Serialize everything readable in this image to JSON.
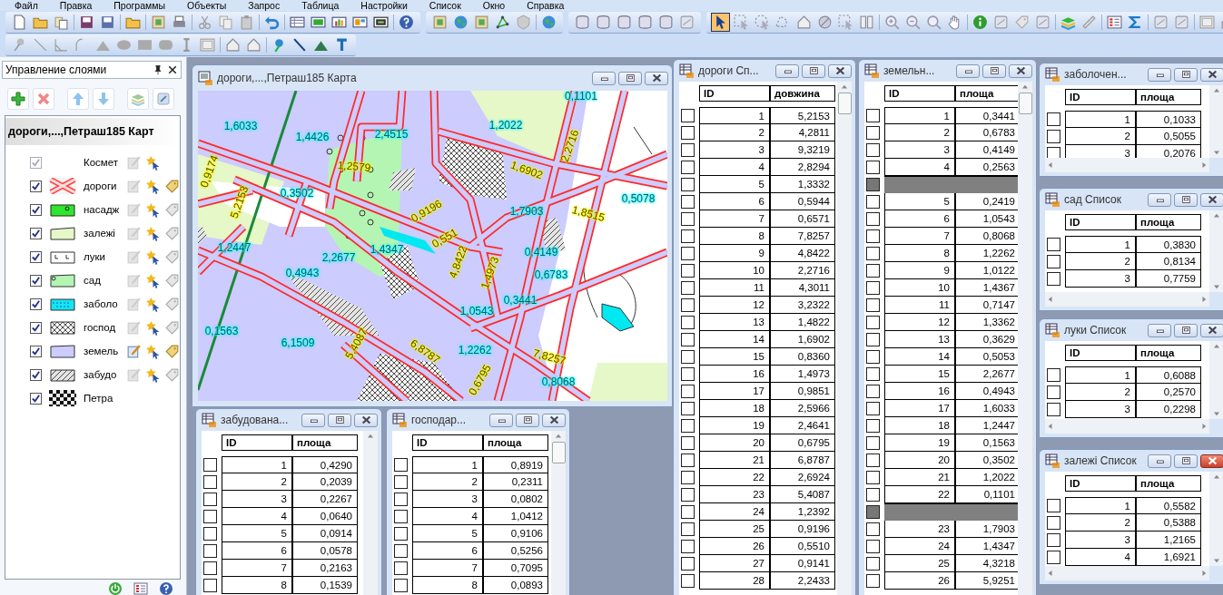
{
  "menu": [
    "Файл",
    "Правка",
    "Программы",
    "Объекты",
    "Запрос",
    "Таблица",
    "Настройки",
    "Список",
    "Окно",
    "Справка"
  ],
  "layer_panel": {
    "title": "Управление слоями",
    "map_name": "дороги,...,Петраш185 Карт",
    "layers": [
      {
        "name": "Космет",
        "kind": "cosmetic",
        "visible": true,
        "disabled": true,
        "editable": false
      },
      {
        "name": "дороги",
        "kind": "road",
        "visible": true,
        "disabled": false,
        "editable": false,
        "labeled": true
      },
      {
        "name": "насадж",
        "kind": "green",
        "visible": true,
        "disabled": false,
        "editable": false,
        "labeled": false
      },
      {
        "name": "залежі",
        "kind": "field",
        "visible": true,
        "disabled": false,
        "editable": false,
        "labeled": false
      },
      {
        "name": "луки",
        "kind": "meadow",
        "visible": true,
        "disabled": false,
        "editable": false,
        "labeled": false
      },
      {
        "name": "сад",
        "kind": "garden",
        "visible": true,
        "disabled": false,
        "editable": false,
        "labeled": false
      },
      {
        "name": "заболо",
        "kind": "swamp",
        "visible": true,
        "disabled": false,
        "editable": false,
        "labeled": false
      },
      {
        "name": "господ",
        "kind": "cross",
        "visible": true,
        "disabled": false,
        "editable": false,
        "labeled": false
      },
      {
        "name": "земель",
        "kind": "land",
        "visible": true,
        "disabled": false,
        "editable": true,
        "labeled": true
      },
      {
        "name": "забудо",
        "kind": "hatch",
        "visible": true,
        "disabled": false,
        "editable": false,
        "labeled": false
      },
      {
        "name": "Петра",
        "kind": "raster",
        "visible": true,
        "disabled": false
      }
    ]
  },
  "map_window": {
    "title": "дороги,...,Петраш185 Карта",
    "labels": [
      {
        "text": "0,1101",
        "kind": "area"
      },
      {
        "text": "1,6033",
        "kind": "area"
      },
      {
        "text": "1,4426",
        "kind": "area"
      },
      {
        "text": "2,4515",
        "kind": "area"
      },
      {
        "text": "1,2022",
        "kind": "area"
      },
      {
        "text": "2,2716",
        "kind": "road"
      },
      {
        "text": "0,9174",
        "kind": "road"
      },
      {
        "text": "1,2579",
        "kind": "road"
      },
      {
        "text": "1,6902",
        "kind": "road"
      },
      {
        "text": "0,3502",
        "kind": "area"
      },
      {
        "text": "5,2153",
        "kind": "road"
      },
      {
        "text": "0,5078",
        "kind": "area"
      },
      {
        "text": "1,7903",
        "kind": "area"
      },
      {
        "text": "1,8515",
        "kind": "road"
      },
      {
        "text": "0,9196",
        "kind": "road"
      },
      {
        "text": "0,551",
        "kind": "road"
      },
      {
        "text": "1,2447",
        "kind": "area"
      },
      {
        "text": "1,4347",
        "kind": "area"
      },
      {
        "text": "2,2677",
        "kind": "area"
      },
      {
        "text": "4,8422",
        "kind": "road"
      },
      {
        "text": "0,4149",
        "kind": "area"
      },
      {
        "text": "1,4973",
        "kind": "road"
      },
      {
        "text": "0,4943",
        "kind": "area"
      },
      {
        "text": "0,6783",
        "kind": "area"
      },
      {
        "text": "0,3441",
        "kind": "area"
      },
      {
        "text": "1,0543",
        "kind": "area"
      },
      {
        "text": "0,1563",
        "kind": "area"
      },
      {
        "text": "6,1509",
        "kind": "area"
      },
      {
        "text": "5,4087",
        "kind": "road"
      },
      {
        "text": "6,8787",
        "kind": "road"
      },
      {
        "text": "1,2262",
        "kind": "area"
      },
      {
        "text": "7,8257",
        "kind": "road"
      },
      {
        "text": "0,6795",
        "kind": "road"
      },
      {
        "text": "0,8068",
        "kind": "area"
      }
    ]
  },
  "tables": [
    {
      "title": "забудована...",
      "active": false,
      "columns": [
        "ID",
        "площа"
      ],
      "rows": [
        {
          "kind": "data",
          "cells": [
            "1",
            "0,4290"
          ]
        },
        {
          "kind": "data",
          "cells": [
            "2",
            "0,2039"
          ]
        },
        {
          "kind": "data",
          "cells": [
            "3",
            "0,2267"
          ]
        },
        {
          "kind": "data",
          "cells": [
            "4",
            "0,0640"
          ]
        },
        {
          "kind": "data",
          "cells": [
            "5",
            "0,0914"
          ]
        },
        {
          "kind": "data",
          "cells": [
            "6",
            "0,0578"
          ]
        },
        {
          "kind": "data",
          "cells": [
            "7",
            "0,2163"
          ]
        },
        {
          "kind": "data",
          "cells": [
            "8",
            "0,1539"
          ]
        }
      ]
    },
    {
      "title": "господар...",
      "active": false,
      "columns": [
        "ID",
        "площа"
      ],
      "rows": [
        {
          "kind": "data",
          "cells": [
            "1",
            "0,8919"
          ]
        },
        {
          "kind": "data",
          "cells": [
            "2",
            "0,2311"
          ]
        },
        {
          "kind": "data",
          "cells": [
            "3",
            "0,0802"
          ]
        },
        {
          "kind": "data",
          "cells": [
            "4",
            "1,0412"
          ]
        },
        {
          "kind": "data",
          "cells": [
            "5",
            "0,9106"
          ]
        },
        {
          "kind": "data",
          "cells": [
            "6",
            "0,5256"
          ]
        },
        {
          "kind": "data",
          "cells": [
            "7",
            "0,7095"
          ]
        },
        {
          "kind": "data",
          "cells": [
            "8",
            "0,0893"
          ]
        }
      ]
    },
    {
      "title": "дороги Сп...",
      "active": false,
      "columns": [
        "ID",
        "довжина"
      ],
      "rows": [
        {
          "kind": "data",
          "cells": [
            "1",
            "5,2153"
          ]
        },
        {
          "kind": "data",
          "cells": [
            "2",
            "4,2811"
          ]
        },
        {
          "kind": "data",
          "cells": [
            "3",
            "9,3219"
          ]
        },
        {
          "kind": "data",
          "cells": [
            "4",
            "2,8294"
          ]
        },
        {
          "kind": "data",
          "cells": [
            "5",
            "1,3332"
          ]
        },
        {
          "kind": "data",
          "cells": [
            "6",
            "0,5944"
          ]
        },
        {
          "kind": "data",
          "cells": [
            "7",
            "0,6571"
          ]
        },
        {
          "kind": "data",
          "cells": [
            "8",
            "7,8257"
          ]
        },
        {
          "kind": "data",
          "cells": [
            "9",
            "4,8422"
          ]
        },
        {
          "kind": "data",
          "cells": [
            "10",
            "2,2716"
          ]
        },
        {
          "kind": "data",
          "cells": [
            "11",
            "4,3011"
          ]
        },
        {
          "kind": "data",
          "cells": [
            "12",
            "3,2322"
          ]
        },
        {
          "kind": "data",
          "cells": [
            "13",
            "1,4822"
          ]
        },
        {
          "kind": "data",
          "cells": [
            "14",
            "1,6902"
          ]
        },
        {
          "kind": "data",
          "cells": [
            "15",
            "0,8360"
          ]
        },
        {
          "kind": "data",
          "cells": [
            "16",
            "1,4973"
          ]
        },
        {
          "kind": "data",
          "cells": [
            "17",
            "0,9851"
          ]
        },
        {
          "kind": "data",
          "cells": [
            "18",
            "2,5966"
          ]
        },
        {
          "kind": "data",
          "cells": [
            "19",
            "2,4641"
          ]
        },
        {
          "kind": "data",
          "cells": [
            "20",
            "0,6795"
          ]
        },
        {
          "kind": "data",
          "cells": [
            "21",
            "6,8787"
          ]
        },
        {
          "kind": "data",
          "cells": [
            "22",
            "2,6924"
          ]
        },
        {
          "kind": "data",
          "cells": [
            "23",
            "5,4087"
          ]
        },
        {
          "kind": "data",
          "cells": [
            "24",
            "1,2392"
          ]
        },
        {
          "kind": "data",
          "cells": [
            "25",
            "0,9196"
          ]
        },
        {
          "kind": "data",
          "cells": [
            "26",
            "0,5510"
          ]
        },
        {
          "kind": "data",
          "cells": [
            "27",
            "0,9141"
          ]
        },
        {
          "kind": "data",
          "cells": [
            "28",
            "2,2433"
          ]
        }
      ]
    },
    {
      "title": "земельн...",
      "active": false,
      "columns": [
        "ID",
        "площа"
      ],
      "rows": [
        {
          "kind": "data",
          "cells": [
            "1",
            "0,3441"
          ]
        },
        {
          "kind": "data",
          "cells": [
            "2",
            "0,6783"
          ]
        },
        {
          "kind": "data",
          "cells": [
            "3",
            "0,4149"
          ]
        },
        {
          "kind": "data",
          "cells": [
            "4",
            "0,2563"
          ]
        },
        {
          "kind": "gap"
        },
        {
          "kind": "data",
          "cells": [
            "5",
            "0,2419"
          ]
        },
        {
          "kind": "data",
          "cells": [
            "6",
            "1,0543"
          ]
        },
        {
          "kind": "data",
          "cells": [
            "7",
            "0,8068"
          ]
        },
        {
          "kind": "data",
          "cells": [
            "8",
            "1,2262"
          ]
        },
        {
          "kind": "data",
          "cells": [
            "9",
            "1,0122"
          ]
        },
        {
          "kind": "data",
          "cells": [
            "10",
            "1,4367"
          ]
        },
        {
          "kind": "data",
          "cells": [
            "11",
            "0,7147"
          ]
        },
        {
          "kind": "data",
          "cells": [
            "12",
            "1,3362"
          ]
        },
        {
          "kind": "data",
          "cells": [
            "13",
            "0,3629"
          ]
        },
        {
          "kind": "data",
          "cells": [
            "14",
            "0,5053"
          ]
        },
        {
          "kind": "data",
          "cells": [
            "15",
            "2,2677"
          ]
        },
        {
          "kind": "data",
          "cells": [
            "16",
            "0,4943"
          ]
        },
        {
          "kind": "data",
          "cells": [
            "17",
            "1,6033"
          ]
        },
        {
          "kind": "data",
          "cells": [
            "18",
            "1,2447"
          ]
        },
        {
          "kind": "data",
          "cells": [
            "19",
            "0,1563"
          ]
        },
        {
          "kind": "data",
          "cells": [
            "20",
            "0,3502"
          ]
        },
        {
          "kind": "data",
          "cells": [
            "21",
            "1,2022"
          ]
        },
        {
          "kind": "data",
          "cells": [
            "22",
            "0,1101"
          ]
        },
        {
          "kind": "gap"
        },
        {
          "kind": "data",
          "cells": [
            "23",
            "1,7903"
          ]
        },
        {
          "kind": "data",
          "cells": [
            "24",
            "1,4347"
          ]
        },
        {
          "kind": "data",
          "cells": [
            "25",
            "4,3218"
          ]
        },
        {
          "kind": "data",
          "cells": [
            "26",
            "5,9251"
          ]
        }
      ]
    },
    {
      "title": "заболочен...",
      "active": false,
      "columns": [
        "ID",
        "площа"
      ],
      "rows": [
        {
          "kind": "data",
          "cells": [
            "1",
            "0,1033"
          ]
        },
        {
          "kind": "data",
          "cells": [
            "2",
            "0,5055"
          ]
        },
        {
          "kind": "data",
          "cells": [
            "3",
            "0,2076"
          ]
        }
      ]
    },
    {
      "title": "сад Список",
      "active": false,
      "columns": [
        "ID",
        "площа"
      ],
      "rows": [
        {
          "kind": "data",
          "cells": [
            "1",
            "0,3830"
          ]
        },
        {
          "kind": "data",
          "cells": [
            "2",
            "0,8134"
          ]
        },
        {
          "kind": "data",
          "cells": [
            "3",
            "0,7759"
          ]
        }
      ]
    },
    {
      "title": "луки Список",
      "active": false,
      "columns": [
        "ID",
        "площа"
      ],
      "rows": [
        {
          "kind": "data",
          "cells": [
            "1",
            "0,6088"
          ]
        },
        {
          "kind": "data",
          "cells": [
            "2",
            "0,2570"
          ]
        },
        {
          "kind": "data",
          "cells": [
            "3",
            "0,2298"
          ]
        }
      ]
    },
    {
      "title": "залежі Список",
      "active": true,
      "columns": [
        "ID",
        "площа"
      ],
      "rows": [
        {
          "kind": "data",
          "cells": [
            "1",
            "0,5582"
          ]
        },
        {
          "kind": "data",
          "cells": [
            "2",
            "0,5388"
          ]
        },
        {
          "kind": "data",
          "cells": [
            "3",
            "1,2165"
          ]
        },
        {
          "kind": "data",
          "cells": [
            "4",
            "1,6921"
          ]
        }
      ]
    }
  ]
}
